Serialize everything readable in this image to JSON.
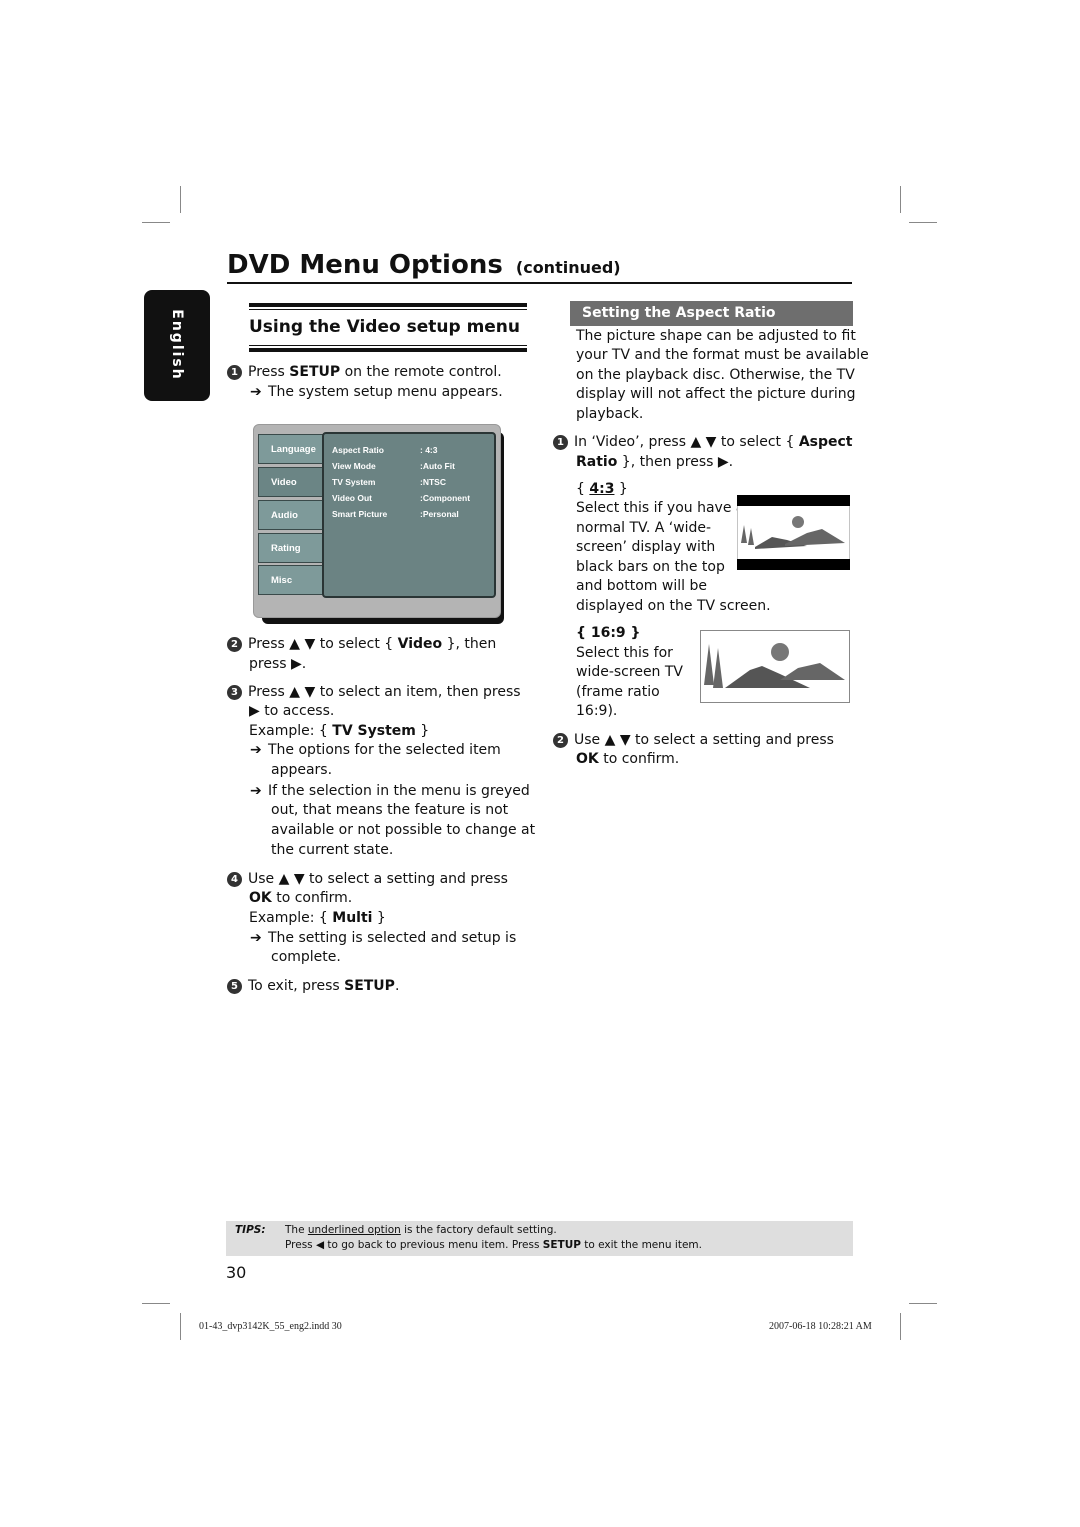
{
  "page": {
    "title": "DVD Menu Options",
    "title_suffix": "(continued)",
    "language_tab": "English",
    "page_number": "30"
  },
  "left_section": {
    "heading": "Using the Video setup menu",
    "step1": {
      "num": "1",
      "pre": "Press ",
      "bold": "SETUP",
      "post": " on the remote control.",
      "result": "The system setup menu appears."
    },
    "setup_menu": {
      "tabs": [
        "Language",
        "Video",
        "Audio",
        "Rating",
        "Misc"
      ],
      "active_tab": "Video",
      "rows": [
        {
          "label": "Aspect Ratio",
          "value": ": 4:3"
        },
        {
          "label": "View Mode",
          "value": ":Auto Fit"
        },
        {
          "label": "TV System",
          "value": ":NTSC"
        },
        {
          "label": "Video Out",
          "value": ":Component"
        },
        {
          "label": "Smart Picture",
          "value": ":Personal"
        }
      ]
    },
    "step2": {
      "num": "2",
      "line1_pre": "Press ▲ ▼ to select { ",
      "line1_bold": "Video",
      "line1_post": " }, then",
      "line2": "press ▶."
    },
    "step3": {
      "num": "3",
      "line1": "Press ▲ ▼ to select an item, then press",
      "line2": "▶ to access.",
      "example_pre": "Example: { ",
      "example_bold": "TV System",
      "example_post": " }",
      "result1_l1": "The options for the selected item",
      "result1_l2": "appears.",
      "result2_l1": "If the selection in the menu is greyed",
      "result2_l2": "out, that means the feature is not",
      "result2_l3": "available or not possible to change at",
      "result2_l4": "the current state."
    },
    "step4": {
      "num": "4",
      "line1": "Use ▲ ▼ to select a setting and press",
      "line2_bold": "OK",
      "line2_post": " to confirm.",
      "example_pre": "Example: { ",
      "example_bold": "Multi",
      "example_post": " }",
      "result_l1": "The setting is selected and setup is",
      "result_l2": "complete."
    },
    "step5": {
      "num": "5",
      "pre": "To exit, press ",
      "bold": "SETUP",
      "post": "."
    }
  },
  "right_section": {
    "heading": "Setting the Aspect Ratio",
    "intro": [
      "The picture shape can be adjusted to fit",
      "your TV and the format must be available",
      "on the playback disc. Otherwise, the TV",
      "display will not affect the picture during",
      "playback."
    ],
    "step1": {
      "num": "1",
      "line1_pre": "In ‘Video’, press ▲ ▼ to select { ",
      "line1_bold": "Aspect",
      "line2_bold": "Ratio",
      "line2_post": " }, then press ▶."
    },
    "option_43": {
      "label": "4:3",
      "default": true,
      "lines": [
        "Select this if you have a",
        "normal TV. A  ‘wide-",
        "screen’ display with",
        "black bars on the top",
        "and bottom will be",
        "displayed on the TV screen."
      ],
      "image": "letterbox-landscape-icon"
    },
    "option_169": {
      "label": "16:9",
      "lines": [
        "Select this for",
        "wide-screen TV",
        "(frame ratio",
        "16:9)."
      ],
      "image": "widescreen-landscape-icon"
    },
    "step2": {
      "num": "2",
      "line1": "Use ▲ ▼ to select a setting and press",
      "line2_bold": "OK",
      "line2_post": " to confirm."
    }
  },
  "tips": {
    "label": "TIPS:",
    "line1_pre": "The ",
    "line1_underlined": "underlined option",
    "line1_post": " is the factory default setting.",
    "line2_pre": "Press  ◀ to go back to previous menu item. Press ",
    "line2_bold": "SETUP",
    "line2_post": " to exit the menu item."
  },
  "footer": {
    "file": "01-43_dvp3142K_55_eng2.indd   30",
    "timestamp": "2007-06-18   10:28:21 AM"
  }
}
